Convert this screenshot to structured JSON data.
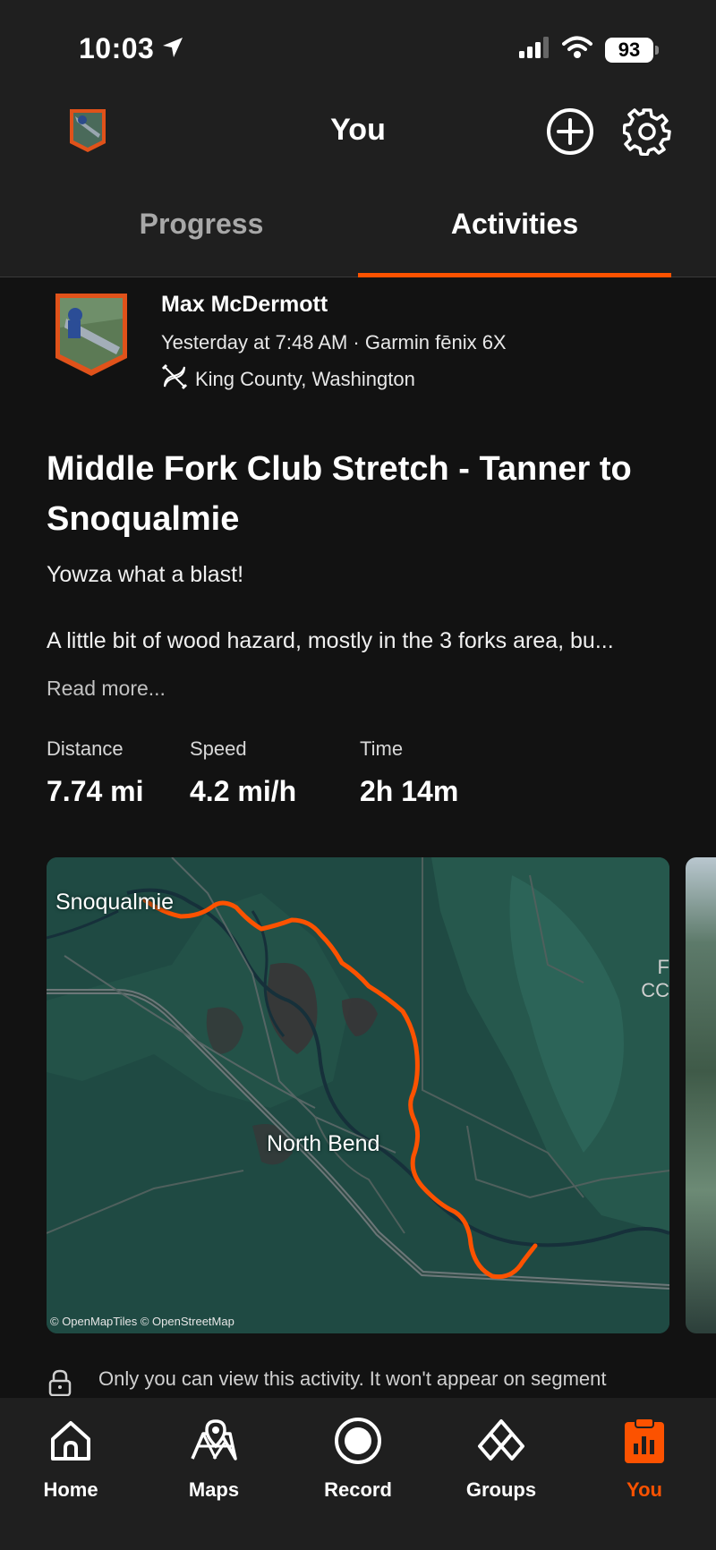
{
  "status_bar": {
    "time": "10:03",
    "battery": "93"
  },
  "header": {
    "title": "You"
  },
  "tabs": [
    {
      "label": "Progress",
      "active": false
    },
    {
      "label": "Activities",
      "active": true
    }
  ],
  "activity": {
    "athlete_name": "Max McDermott",
    "meta": "Yesterday at 7:48 AM · Garmin fēnix 6X",
    "location": "King County, Washington",
    "title": "Middle Fork Club Stretch - Tanner to Snoqualmie",
    "description_line1": "Yowza what a blast!",
    "description_line2": "A little bit of wood hazard, mostly in the 3 forks area, bu...",
    "read_more": "Read more...",
    "stats": [
      {
        "label": "Distance",
        "value": "7.74 mi"
      },
      {
        "label": "Speed",
        "value": "4.2 mi/h"
      },
      {
        "label": "Time",
        "value": "2h 14m"
      }
    ],
    "map": {
      "label_snoqualmie": "Snoqualmie",
      "label_north_bend": "North Bend",
      "edge_text_1": "F",
      "edge_text_2": "CC",
      "attribution": "© OpenMapTiles © OpenStreetMap"
    },
    "privacy_notice": "Only you can view this activity. It won't appear on segment leaderboards and may not count toward some challenges."
  },
  "bottom_nav": [
    {
      "label": "Home",
      "active": false
    },
    {
      "label": "Maps",
      "active": false
    },
    {
      "label": "Record",
      "active": false
    },
    {
      "label": "Groups",
      "active": false
    },
    {
      "label": "You",
      "active": true
    }
  ],
  "colors": {
    "accent": "#fc5200",
    "background": "#121212",
    "surface": "#1f1f1f",
    "map_base": "#1f4a43"
  }
}
